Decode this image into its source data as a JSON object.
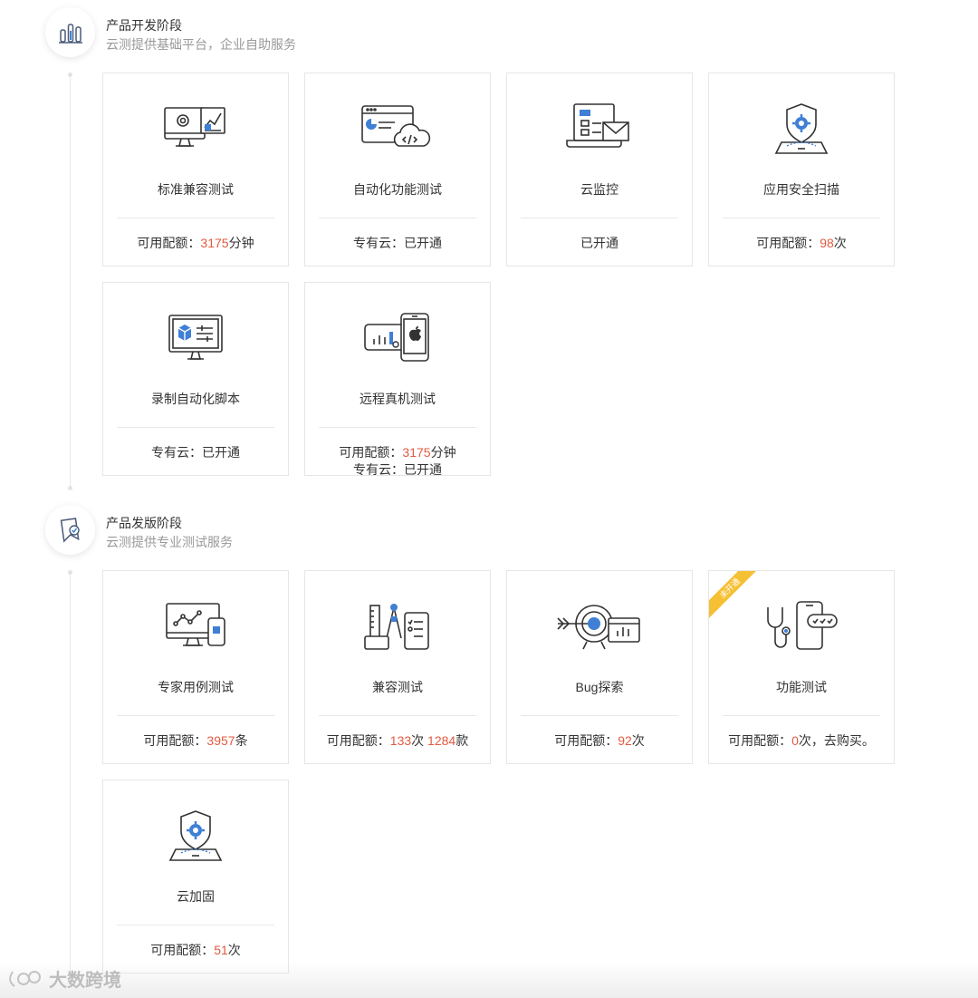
{
  "stages": [
    {
      "title": "产品开发阶段",
      "subtitle": "云测提供基础平台，企业自助服务",
      "icon": "bar-chart-icon",
      "cards": [
        {
          "title": "标准兼容测试",
          "icon": "monitor-gear-chart-icon",
          "footer": [
            [
              "可用配额：",
              ""
            ],
            [
              "3175",
              "hl"
            ],
            [
              "分钟",
              ""
            ]
          ]
        },
        {
          "title": "自动化功能测试",
          "icon": "browser-cloud-code-icon",
          "footer": [
            [
              "专有云：已开通",
              ""
            ]
          ]
        },
        {
          "title": "云监控",
          "icon": "laptop-mail-icon",
          "footer": [
            [
              "已开通",
              ""
            ]
          ]
        },
        {
          "title": "应用安全扫描",
          "icon": "shield-phone-icon",
          "footer": [
            [
              "可用配额：",
              ""
            ],
            [
              "98",
              "hl"
            ],
            [
              "次",
              ""
            ]
          ]
        },
        {
          "title": "录制自动化脚本",
          "icon": "monitor-cube-icon",
          "footer": [
            [
              "专有云：已开通",
              ""
            ]
          ]
        },
        {
          "title": "远程真机测试",
          "icon": "phones-apple-icon",
          "footer": [
            [
              "可用配额：",
              ""
            ],
            [
              "3175",
              "hl"
            ],
            [
              "分钟",
              ""
            ]
          ],
          "footer2": "专有云：已开通"
        }
      ]
    },
    {
      "title": "产品发版阶段",
      "subtitle": "云测提供专业测试服务",
      "icon": "bookmark-check-icon",
      "cards": [
        {
          "title": "专家用例测试",
          "icon": "monitor-graph-phone-icon",
          "footer": [
            [
              "可用配额：",
              ""
            ],
            [
              "3957",
              "hl"
            ],
            [
              "条",
              ""
            ]
          ]
        },
        {
          "title": "兼容测试",
          "icon": "ruler-compass-phone-icon",
          "footer": [
            [
              "可用配额：",
              ""
            ],
            [
              "133",
              "hl"
            ],
            [
              "次 ",
              ""
            ],
            [
              "1284",
              "hl"
            ],
            [
              "款",
              ""
            ]
          ]
        },
        {
          "title": "Bug探索",
          "icon": "target-arrow-icon",
          "footer": [
            [
              "可用配额：",
              ""
            ],
            [
              "92",
              "hl"
            ],
            [
              "次",
              ""
            ]
          ]
        },
        {
          "title": "功能测试",
          "icon": "stethoscope-phone-icon",
          "ribbon": "未开通",
          "footer": [
            [
              "可用配额：",
              ""
            ],
            [
              "0",
              "hl"
            ],
            [
              "次，去购买。",
              ""
            ]
          ]
        },
        {
          "title": "云加固",
          "icon": "shield-phone-icon",
          "footer": [
            [
              "可用配额：",
              ""
            ],
            [
              "51",
              "hl"
            ],
            [
              "次",
              ""
            ]
          ]
        }
      ]
    }
  ],
  "watermark": "大数跨境",
  "colors": {
    "highlight": "#e4593f",
    "ribbon": "#f6c035",
    "accent": "#3f7fd6"
  }
}
